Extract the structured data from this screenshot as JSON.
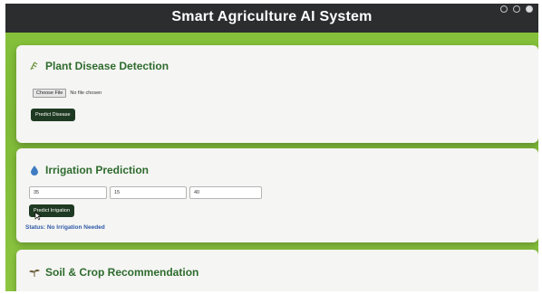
{
  "header": {
    "title": "Smart Agriculture AI System"
  },
  "disease": {
    "title": "Plant Disease Detection",
    "icon": "leaf-icon",
    "file_button_label": "Choose File",
    "file_status": "No file chosen",
    "predict_label": "Predict Disease"
  },
  "irrigation": {
    "title": "Irrigation Prediction",
    "icon": "water-drop-icon",
    "inputs": [
      "35",
      "15",
      "40"
    ],
    "predict_label": "Predict Irrigation",
    "status": "Status: No Irrigation Needed"
  },
  "soil": {
    "title": "Soil & Crop Recommendation",
    "icon": "seedling-icon"
  },
  "colors": {
    "header_bg": "#2b2d2e",
    "page_bg": "#86c23b",
    "card_title": "#2e6b2e",
    "button_bg": "#1f3a22",
    "status_text": "#2f5aa8"
  }
}
